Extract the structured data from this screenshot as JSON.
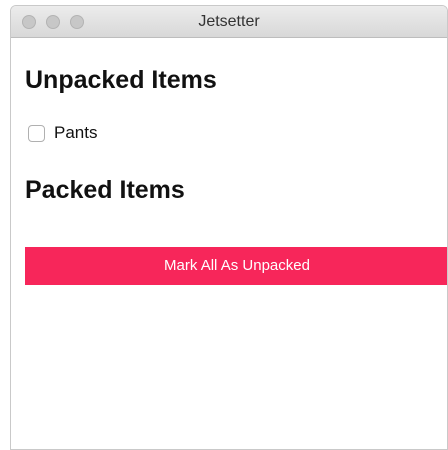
{
  "window": {
    "title": "Jetsetter"
  },
  "unpacked": {
    "heading": "Unpacked Items",
    "items": [
      {
        "label": "Pants",
        "checked": false
      }
    ]
  },
  "packed": {
    "heading": "Packed Items",
    "items": []
  },
  "actions": {
    "mark_all_unpacked_label": "Mark All As Unpacked"
  },
  "colors": {
    "accent": "#f7265a",
    "traffic_light_inactive": "#c7c7c7"
  }
}
